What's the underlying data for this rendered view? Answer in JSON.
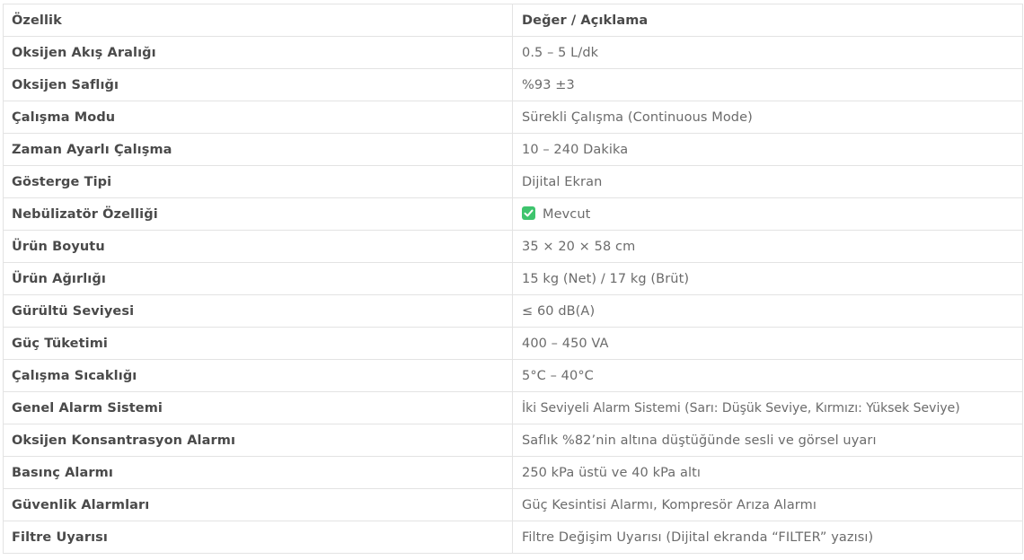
{
  "table": {
    "header": {
      "feature": "Özellik",
      "value": "Değer / Açıklama"
    },
    "rows": [
      {
        "feature": "Oksijen Akış Aralığı",
        "value": "0.5 – 5 L/dk"
      },
      {
        "feature": "Oksijen Saflığı",
        "value": "%93 ±3"
      },
      {
        "feature": "Çalışma Modu",
        "value": "Sürekli Çalışma (Continuous Mode)"
      },
      {
        "feature": "Zaman Ayarlı Çalışma",
        "value": "10 – 240 Dakika"
      },
      {
        "feature": "Gösterge Tipi",
        "value": "Dijital Ekran"
      },
      {
        "feature": "Nebülizatör Özelliği",
        "value": "Mevcut",
        "icon": "check-mark-icon"
      },
      {
        "feature": "Ürün Boyutu",
        "value": "35 × 20 × 58 cm"
      },
      {
        "feature": "Ürün Ağırlığı",
        "value": "15 kg (Net) / 17 kg (Brüt)"
      },
      {
        "feature": "Gürültü Seviyesi",
        "value": "≤ 60 dB(A)"
      },
      {
        "feature": "Güç Tüketimi",
        "value": "400 – 450 VA"
      },
      {
        "feature": "Çalışma Sıcaklığı",
        "value": "5°C – 40°C"
      },
      {
        "feature": "Genel Alarm Sistemi",
        "value": "İki Seviyeli Alarm Sistemi (Sarı: Düşük Seviye, Kırmızı: Yüksek Seviye)"
      },
      {
        "feature": "Oksijen Konsantrasyon Alarmı",
        "value": "Saflık %82’nin altına düştüğünde sesli ve görsel uyarı"
      },
      {
        "feature": "Basınç Alarmı",
        "value": "250 kPa üstü ve 40 kPa altı"
      },
      {
        "feature": "Güvenlik Alarmları",
        "value": "Güç Kesintisi Alarmı, Kompresör Arıza Alarmı"
      },
      {
        "feature": "Filtre Uyarısı",
        "value": "Filtre Değişim Uyarısı (Dijital ekranda “FILTER” yazısı)"
      }
    ]
  },
  "colors": {
    "border": "#e3e3e3",
    "feature_text": "#4a4a4a",
    "value_text": "#6b6b6b",
    "check_icon": "#3ec46d"
  }
}
